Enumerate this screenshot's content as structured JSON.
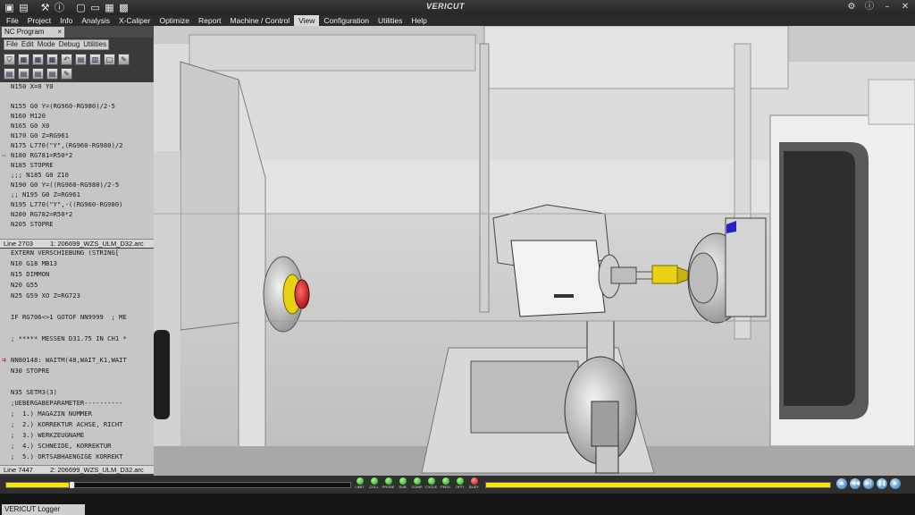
{
  "window": {
    "title": "VERICUT",
    "quick_access": [
      "save-icon",
      "print-icon",
      "tool-icon",
      "info-icon",
      "layout-single-icon",
      "layout-dual-icon",
      "layout-quad-icon",
      "snapshot-icon"
    ],
    "controls": [
      "settings-icon",
      "info-icon",
      "minimize-icon",
      "close-icon"
    ]
  },
  "menu": {
    "items": [
      {
        "label": "File",
        "active": false
      },
      {
        "label": "Project",
        "active": false
      },
      {
        "label": "Info",
        "active": false
      },
      {
        "label": "Analysis",
        "active": false
      },
      {
        "label": "X-Caliper",
        "active": false
      },
      {
        "label": "Optimize",
        "active": false
      },
      {
        "label": "Report",
        "active": false
      },
      {
        "label": "Machine / Control",
        "active": false
      },
      {
        "label": "View",
        "active": true
      },
      {
        "label": "Configuration",
        "active": false
      },
      {
        "label": "Utilities",
        "active": false
      },
      {
        "label": "Help",
        "active": false
      }
    ]
  },
  "nc_panel": {
    "tab_label": "NC Program",
    "tab_close": "×",
    "menu": [
      "File",
      "Edit",
      "Mode",
      "Debug",
      "Utilities"
    ],
    "top_pane": {
      "lines": [
        "N150 X=0 Y0",
        "",
        "N155 G0 Y=(RG960-RG980)/2-5",
        "N160 M120",
        "N165 G0 X0",
        "N170 G0 Z=RG961",
        "N175 L770(\"Y\",(RG960-RG980)/2",
        "N180 RG781=R50*2",
        "N185 STOPRE",
        ";;; N185 G0 Z10",
        "N190 G0 Y=((RG960-RG980)/2-5",
        ";; N195 G0 Z=RG961",
        "N195 L770(\"Y\",-((RG960-RG980)",
        "N200 RG782=R50*2",
        "N205 STOPRE"
      ],
      "current_line_marker": "⇨"
    },
    "top_status": {
      "line": "Line 2703",
      "file": "1: 206699_WZS_ULM_D32.arc"
    },
    "bottom_pane": {
      "lines": [
        "EXTERN VERSCHIEBUNG (STRING[",
        "N10 G18 MB13",
        "N15 DIMMON",
        "N20 G55",
        "N25 G59 XO Z=RG723",
        "",
        "IF RG706<>1 GOTOF NN9999  ; ME",
        "",
        "; ***** MESSEN D31.75 IN CH1 *",
        "",
        "NN80148: WAITM(48,WAIT_K1,WAIT",
        "N30 STOPRE",
        "",
        "N35 SETM3(3)",
        ";UEBERGABEPARAMETER----------",
        ";  1.) MAGAZIN NUMMER",
        ";  2.) KORREKTUR ACHSE, RICHT",
        ";  3.) WERKZEUGNAME",
        ";  4.) SCHNEIDE, KORREKTUR",
        ";  5.) ORTSABHAENGIGE KORREKT"
      ],
      "error_marker": "⇉"
    },
    "bottom_status": {
      "line": "Line 7447",
      "file": "2: 206699_WZS_ULM_D32.arc"
    }
  },
  "timeline": {
    "progress": 0.19,
    "leds": [
      {
        "label": "LIMIT",
        "color": "#22c022"
      },
      {
        "label": "COLL",
        "color": "#22c022"
      },
      {
        "label": "PROBE",
        "color": "#22c022"
      },
      {
        "label": "SUB",
        "color": "#22c022"
      },
      {
        "label": "COMP",
        "color": "#22c022"
      },
      {
        "label": "CYCLE",
        "color": "#22c022"
      },
      {
        "label": "FEED",
        "color": "#22c022"
      },
      {
        "label": "OPTI",
        "color": "#22c022"
      },
      {
        "label": "BUSY",
        "color": "#cc1111"
      }
    ],
    "playback": [
      "eject-icon",
      "rewind-icon",
      "step-icon",
      "pause-icon",
      "play-icon"
    ]
  },
  "logger": {
    "tab_label": "VERICUT Logger"
  },
  "colors": {
    "accent_yellow": "#f7e400",
    "active_menu": "#d8d8d8",
    "code_bg": "#c6c6c6",
    "part_yellow": "#e8d214",
    "red_part": "#d81c1c",
    "blue_marker": "#2222cc"
  }
}
